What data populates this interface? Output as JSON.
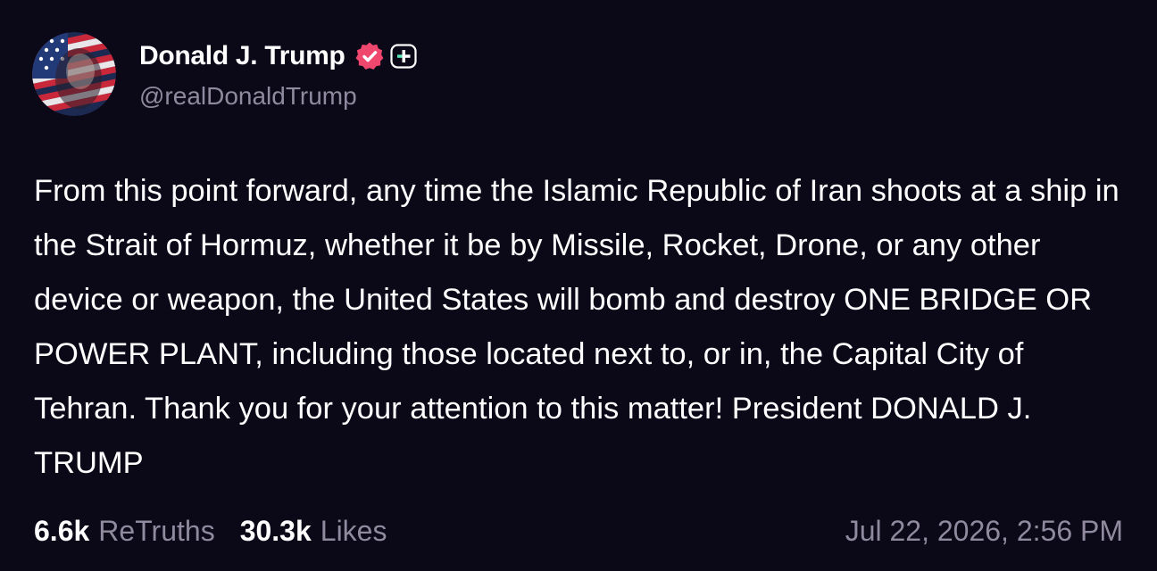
{
  "post": {
    "display_name": "Donald J. Trump",
    "handle": "@realDonaldTrump",
    "verified_icon": "verified-badge-icon",
    "plus_icon": "plus-badge-icon",
    "body_text": "From this point forward, any time the Islamic Republic of Iran shoots at a ship in the Strait of Hormuz, whether it be by Missile, Rocket, Drone, or any other device or weapon, the United States will bomb and destroy ONE BRIDGE OR POWER PLANT, including those located next to, or in, the Capital City of Tehran. Thank you for your attention to this matter! President DONALD J. TRUMP",
    "retruths_count": "6.6k",
    "retruths_label": "ReTruths",
    "likes_count": "30.3k",
    "likes_label": "Likes",
    "timestamp": "Jul 22, 2026, 2:56 PM"
  },
  "colors": {
    "background": "#0b0818",
    "text_primary": "#ffffff",
    "text_secondary": "#8f8a9e",
    "verified_badge": "#f0476e",
    "plus_badge_accent": "#58e8b5"
  }
}
